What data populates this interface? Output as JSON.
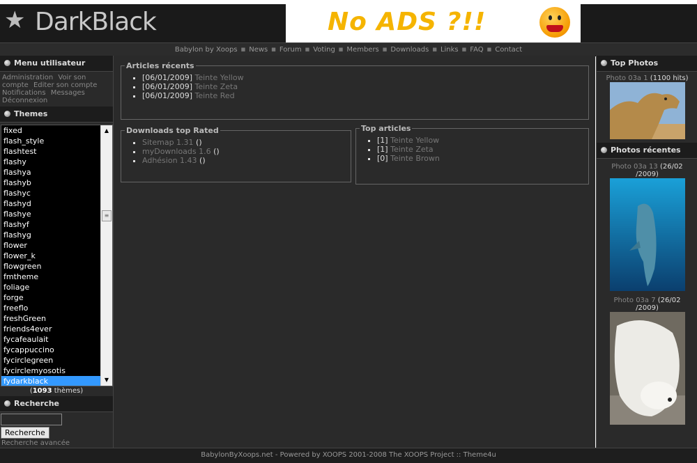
{
  "header": {
    "logo_text": "DarkBlack",
    "banner_text": "No ADS ?!!"
  },
  "nav": {
    "items": [
      "Babylon by Xoops",
      "News",
      "Forum",
      "Voting",
      "Members",
      "Downloads",
      "Links",
      "FAQ",
      "Contact"
    ]
  },
  "left": {
    "user_menu_title": "Menu utilisateur",
    "user_menu_links": [
      "Administration",
      "Voir son compte",
      "Editer son compte",
      "Notifications",
      "Messages",
      "Déconnexion"
    ],
    "themes_title": "Themes",
    "themes": [
      "fixed",
      "flash_style",
      "flashtest",
      "flashy",
      "flashya",
      "flashyb",
      "flashyc",
      "flashyd",
      "flashye",
      "flashyf",
      "flashyg",
      "flower",
      "flower_k",
      "flowgreen",
      "fmtheme",
      "foliage",
      "forge",
      "freeflo",
      "freshGreen",
      "friends4ever",
      "fycafeaulait",
      "fycappuccino",
      "fycirclegreen",
      "fycirclemyosotis",
      "fydarkblack"
    ],
    "selected_theme": "fydarkblack",
    "theme_count_number": "1093",
    "theme_count_suffix": " thèmes)",
    "theme_count_prefix": "(",
    "search_title": "Recherche",
    "search_value": "",
    "search_button": "Recherche",
    "advanced_search": "Recherche avancée"
  },
  "center": {
    "recent_articles": {
      "title": "Articles récents",
      "items": [
        {
          "date": "[06/01/2009]",
          "title": "Teinte Yellow"
        },
        {
          "date": "[06/01/2009]",
          "title": "Teinte Zeta"
        },
        {
          "date": "[06/01/2009]",
          "title": "Teinte Red"
        }
      ]
    },
    "downloads": {
      "title": "Downloads top Rated",
      "items": [
        {
          "name": "Sitemap 1.31",
          "score": "()"
        },
        {
          "name": "myDownloads 1.6",
          "score": "()"
        },
        {
          "name": "Adhésion 1.43",
          "score": "()"
        }
      ]
    },
    "top_articles": {
      "title": "Top articles",
      "items": [
        {
          "count": "[1]",
          "title": "Teinte Yellow"
        },
        {
          "count": "[1]",
          "title": "Teinte Zeta"
        },
        {
          "count": "[0]",
          "title": "Teinte Brown"
        }
      ]
    }
  },
  "right": {
    "top_photos_title": "Top Photos",
    "top_photo": {
      "name": "Photo 03a 1",
      "info": "(1100 hits)"
    },
    "recent_title": "Photos récentes",
    "recent_photos": [
      {
        "name": "Photo 03a 13",
        "info_line1": "(26/02",
        "info_line2": "/2009)"
      },
      {
        "name": "Photo 03a 7",
        "info_line1": "(26/02",
        "info_line2": "/2009)"
      }
    ]
  },
  "footer": {
    "text": "BabylonByXoops.net - Powered by XOOPS 2001-2008 The XOOPS Project :: Theme4u"
  },
  "colors": {
    "background": "#2a2a2a",
    "header_bg": "#1a1a1a",
    "selection": "#3399ff",
    "banner_text": "#f5b400"
  }
}
